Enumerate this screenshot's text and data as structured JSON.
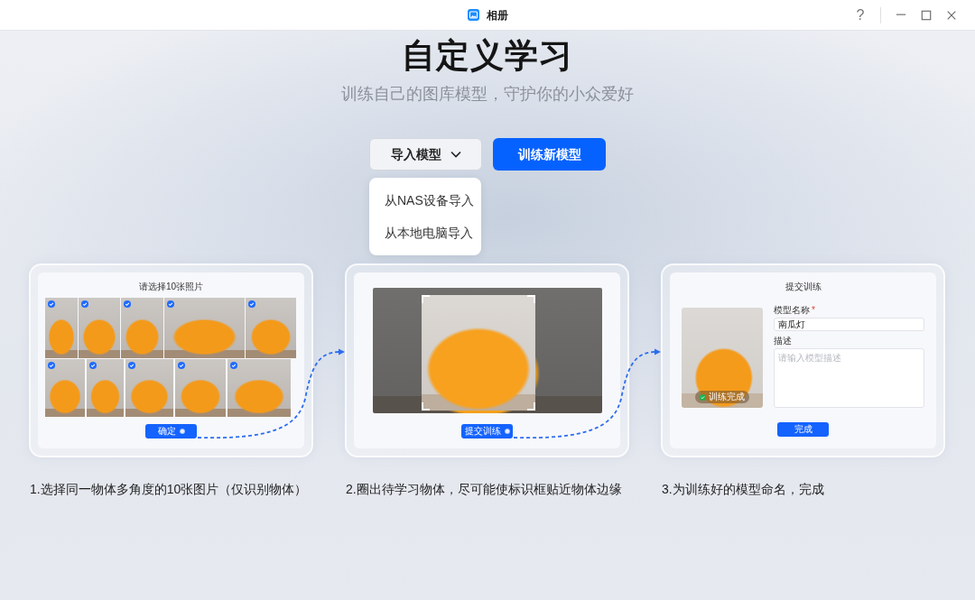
{
  "window": {
    "title": "相册",
    "help": "?"
  },
  "header": {
    "title": "自定义学习",
    "subtitle": "训练自己的图库模型，守护你的小众爱好"
  },
  "actions": {
    "import_button": {
      "label": "导入模型",
      "expanded": true
    },
    "import_menu": [
      {
        "label": "从NAS设备导入"
      },
      {
        "label": "从本地电脑导入"
      }
    ],
    "train_button": {
      "label": "训练新模型"
    }
  },
  "steps": [
    {
      "kind": "select",
      "preview": {
        "title": "请选择10张照片",
        "photos": [
          {
            "checked": true
          },
          {
            "checked": true
          },
          {
            "checked": true
          },
          {
            "checked": true
          },
          {
            "checked": true
          },
          {
            "checked": true
          },
          {
            "checked": true
          },
          {
            "checked": true
          },
          {
            "checked": true
          },
          {
            "checked": true
          }
        ],
        "button": {
          "label": "确定",
          "pointer": true
        }
      },
      "caption": "1.选择同一物体多角度的10张图片（仅识别物体）"
    },
    {
      "kind": "crop",
      "preview": {
        "button": {
          "label": "提交训练",
          "pointer": true
        }
      },
      "caption": "2.圈出待学习物体，尽可能使标识框贴近物体边缘"
    },
    {
      "kind": "submit",
      "preview": {
        "title": "提交训练",
        "badge": "训练完成",
        "fields": [
          {
            "kind": "input",
            "label": "模型名称",
            "required_mark": "*",
            "value": "南瓜灯"
          },
          {
            "kind": "textarea",
            "label": "描述",
            "placeholder": "请输入模型描述"
          }
        ],
        "button": {
          "label": "完成",
          "pointer": false
        }
      },
      "caption": "3.为训练好的模型命名，完成"
    }
  ]
}
